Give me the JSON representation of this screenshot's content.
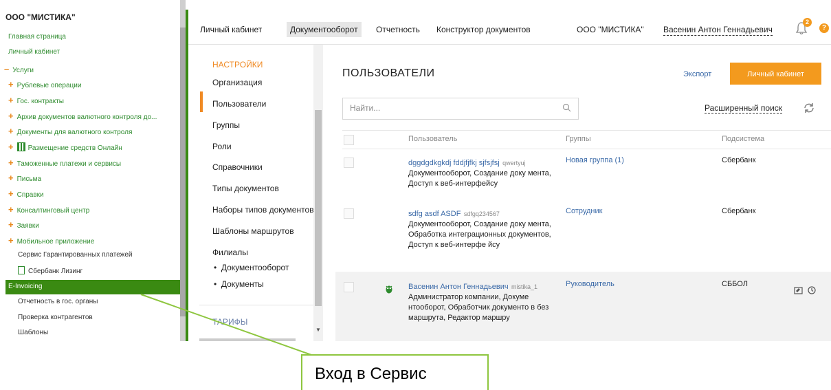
{
  "left_tree": {
    "org_name": "ООО \"МИСТИКА\"",
    "items": [
      {
        "label": "Главная страница"
      },
      {
        "label": "Личный кабинет"
      },
      {
        "label": "Услуги"
      },
      {
        "label": "Рублевые операции"
      },
      {
        "label": "Гос. контракты"
      },
      {
        "label": "Архив документов валютного контроля до..."
      },
      {
        "label": "Документы для валютного контроля"
      },
      {
        "label": "Размещение средств Онлайн"
      },
      {
        "label": "Таможенные платежи и сервисы"
      },
      {
        "label": "Письма"
      },
      {
        "label": "Справки"
      },
      {
        "label": "Консалтинговый центр"
      },
      {
        "label": "Заявки"
      },
      {
        "label": "Мобильное приложение"
      },
      {
        "label": "Сервис Гарантированных платежей"
      },
      {
        "label": "Сбербанк Лизинг"
      },
      {
        "label": "E-Invoicing"
      },
      {
        "label": "Отчетность в гос. органы"
      },
      {
        "label": "Проверка контрагентов"
      },
      {
        "label": "Шаблоны"
      }
    ]
  },
  "top_nav": {
    "tabs": [
      "Личный кабинет",
      "Документооборот",
      "Отчетность",
      "Конструктор документов"
    ],
    "org": "ООО \"МИСТИКА\"",
    "user": "Васенин Антон Геннадьевич",
    "notifications_count": "2",
    "help": "?"
  },
  "settings": {
    "header": "НАСТРОЙКИ",
    "items": [
      "Организация",
      "Пользователи",
      "Группы",
      "Роли",
      "Справочники",
      "Типы документов",
      "Наборы типов документов",
      "Шаблоны маршрутов",
      "Филиалы"
    ],
    "branches": [
      "Документооборот",
      "Документы"
    ],
    "tariffs": "ТАРИФЫ"
  },
  "main": {
    "title": "ПОЛЬЗОВАТЕЛИ",
    "export": "Экспорт",
    "cabinet_button": "Личный кабинет",
    "search_placeholder": "Найти...",
    "advanced_search": "Расширенный поиск",
    "columns": [
      "Пользователь",
      "Группы",
      "Подсистема"
    ],
    "rows": [
      {
        "name": "dggdgdkgkdj fddjfjfkj sjfsjfsj",
        "login": "qwertyuj",
        "permissions": "Документооборот, Создание доку мента, Доступ к веб-интерфейсу",
        "group": "Новая группа (1)",
        "subsystem": "Сбербанк"
      },
      {
        "name": "sdfg asdf ASDF",
        "login": "sdfgq234567",
        "permissions": "Документооборот, Создание доку мента, Обработка интеграционных документов, Доступ к веб-интерфе йсу",
        "group": "Сотрудник",
        "subsystem": "Сбербанк"
      },
      {
        "name": "Васенин Антон Геннадьевич",
        "login": "mistika_1",
        "permissions": "Администратор компании, Докуме нтооборот, Обработчик документо в без маршрута, Редактор маршру",
        "group": "Руководитель",
        "subsystem": "СББОЛ"
      }
    ]
  },
  "callout": {
    "text": "Вход в Сервис"
  },
  "colors": {
    "accent_green": "#3a8a12",
    "accent_orange": "#f39a1e",
    "link_blue": "#3b6aa8",
    "callout_border": "#8ec63f"
  }
}
